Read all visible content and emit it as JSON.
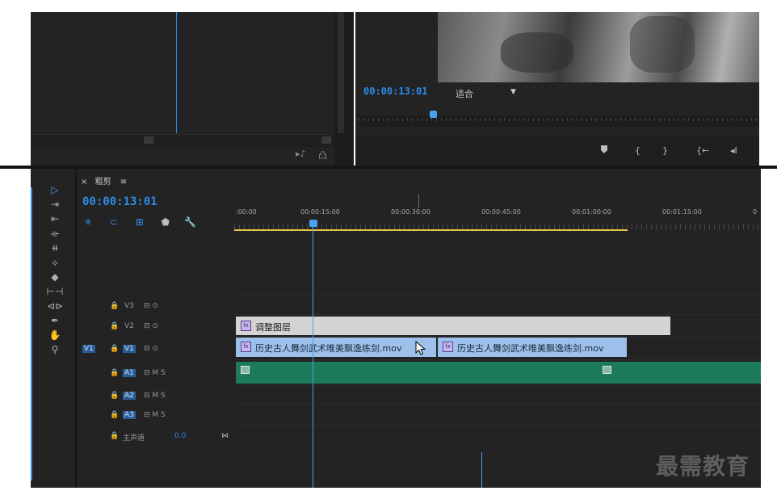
{
  "source_monitor": {
    "ctrl_icons": [
      "export-frame-icon",
      "insert-icon"
    ]
  },
  "program_monitor": {
    "timecode": "00:00:13:01",
    "fit_label": "适合",
    "fit_arrow": "▼",
    "controls": [
      "add-marker-icon",
      "mark-in-icon",
      "mark-out-icon",
      "go-to-in-icon",
      "step-back-icon"
    ]
  },
  "timeline": {
    "tab_close": "×",
    "tab_label": "粗剪",
    "tab_menu": "≡",
    "timecode": "00:00:13:01",
    "ruler_labels": [
      ":00:00",
      "00:00:15:00",
      "00:00:30:00",
      "00:00:45:00",
      "00:01:00:00",
      "00:01:15:00",
      "0"
    ],
    "tracks": [
      {
        "lock": "🔒",
        "name": "V3",
        "icons": "⊟ ⊙"
      },
      {
        "lock": "🔒",
        "name": "V2",
        "icons": "⊟ ⊙"
      },
      {
        "source": "V1",
        "lock": "🔒",
        "name": "V1",
        "icons": "⊟ ⊙"
      },
      {
        "lock": "🔒",
        "name": "A1",
        "icons": "⊟ M S"
      },
      {
        "lock": "🔒",
        "name": "A2",
        "icons": "⊟ M S"
      },
      {
        "lock": "🔒",
        "name": "A3",
        "icons": "⊟ M S"
      }
    ],
    "master": {
      "label": "主声道",
      "value": "0.0"
    },
    "clips": {
      "adjustment": "调整图层",
      "v1_a": "历史古人舞剑武术唯美飘逸练剑.mov",
      "v1_b": "历史古人舞剑武术唯美飘逸练剑.mov"
    }
  },
  "colors": {
    "accent": "#2d8ceb",
    "workarea": "#e8c84a",
    "audio_clip": "#1e7a5c",
    "video_clip": "#9ec1eb",
    "adjustment_clip": "#d4d4d4"
  },
  "watermark": "最需教育"
}
